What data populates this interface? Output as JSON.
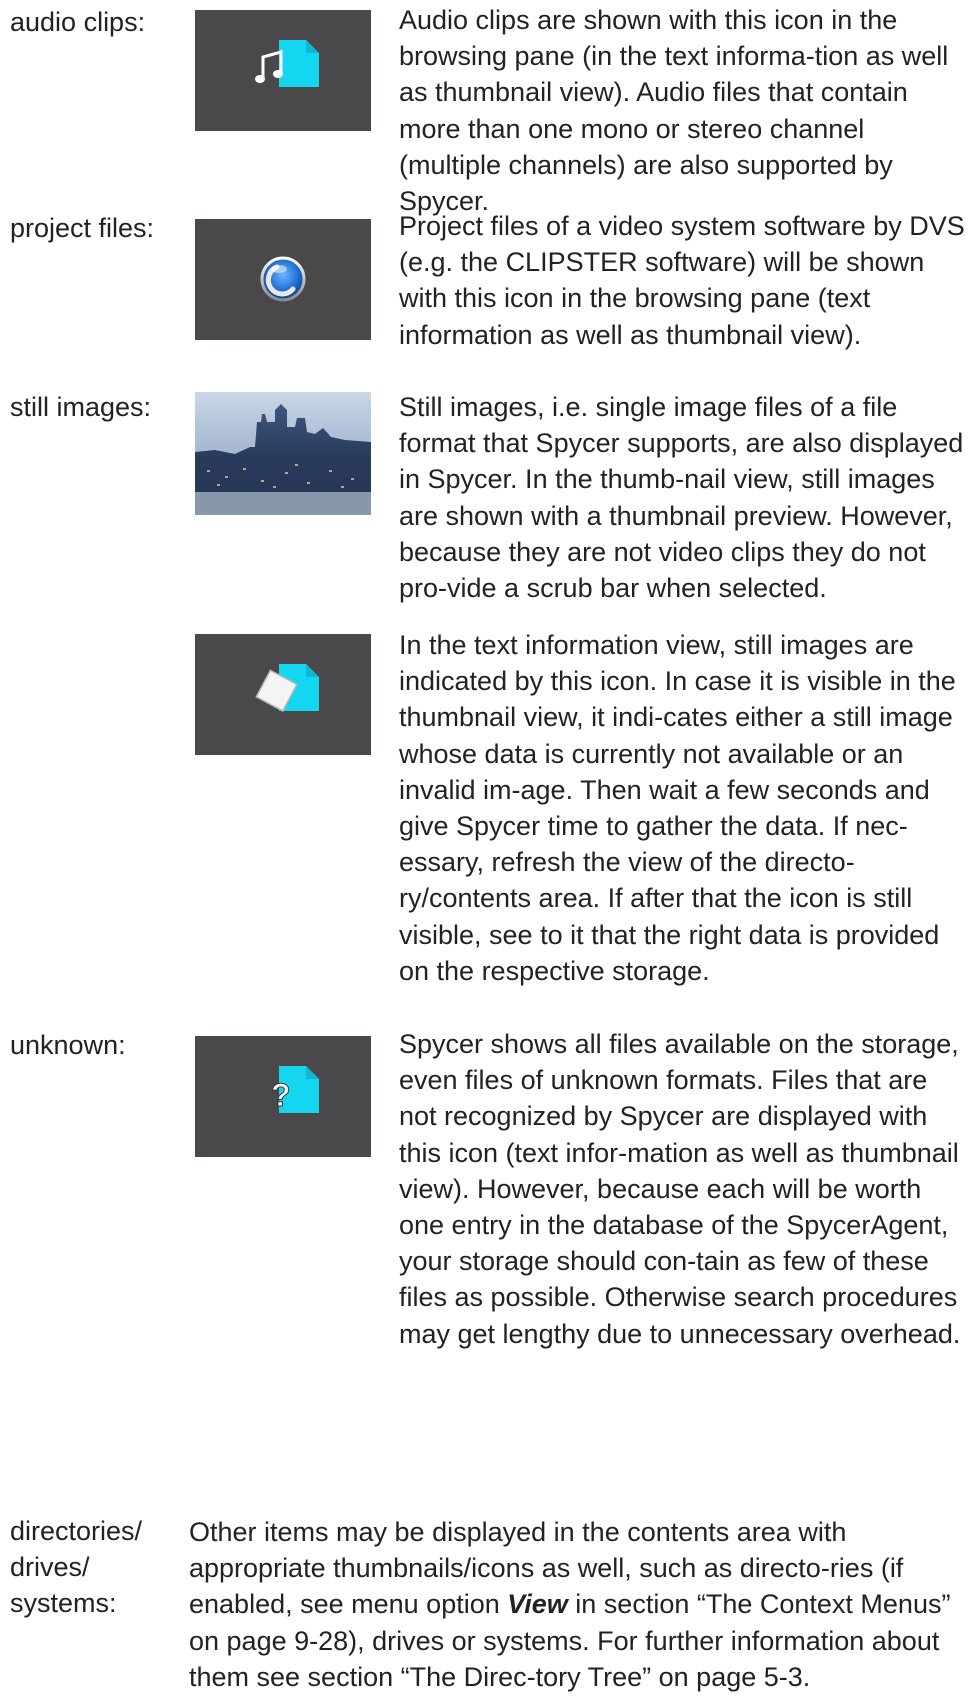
{
  "items": [
    {
      "label": "audio clips:",
      "icon": "audio-file-icon",
      "description": "Audio clips are shown with this icon in the browsing pane (in the text informa-tion as well as thumbnail view). Audio files that contain more than one mono or stereo channel (multiple channels) are also supported by Spycer."
    },
    {
      "label": "project files:",
      "icon": "project-file-icon",
      "description": "Project files of a video system software by DVS (e.g. the CLIPSTER software) will be shown with this icon in the browsing pane (text information as well as thumbnail view)."
    },
    {
      "label": "still images:",
      "icon": "city-thumbnail-image",
      "description": "Still images, i.e. single image files of a file format that Spycer supports, are also displayed in Spycer. In the thumb-nail view, still images are shown with a thumbnail preview. However, because they are not video clips they do not pro-vide a scrub bar when selected."
    },
    {
      "label": "",
      "icon": "still-image-file-icon",
      "description": "In the text information view, still images are indicated by this icon. In case it is visible in the thumbnail view, it indi-cates either a still image whose data is currently not available or an invalid im-age. Then wait a few seconds and give Spycer time to gather the data. If nec-essary, refresh the view of the directo-ry/contents area. If after that the icon is still visible, see to it that the right data is provided on the respective storage."
    },
    {
      "label": "unknown:",
      "icon": "unknown-file-icon",
      "description": "Spycer shows all files available on the storage, even files of unknown formats. Files that are not recognized by Spycer are displayed with this icon (text infor-mation as well as thumbnail view). However, because each will be worth one entry in the database of the SpycerAgent, your storage should con-tain as few of these files as possible. Otherwise search procedures may get lengthy due to unnecessary overhead."
    }
  ],
  "last": {
    "label": "directories/ drives/ systems:",
    "desc_before": "Other items may be displayed in the contents area with appropriate thumbnails/icons as well, such as directo-ries (if enabled, see menu option ",
    "desc_bold": "View",
    "desc_after": " in section “The Context Menus” on page 9-28), drives or systems. For further information about them see section “The Direc-tory Tree” on page 5-3."
  },
  "colors": {
    "icon_background": "#4a484a",
    "file_cyan": "#14d6ee",
    "text": "#222222"
  }
}
